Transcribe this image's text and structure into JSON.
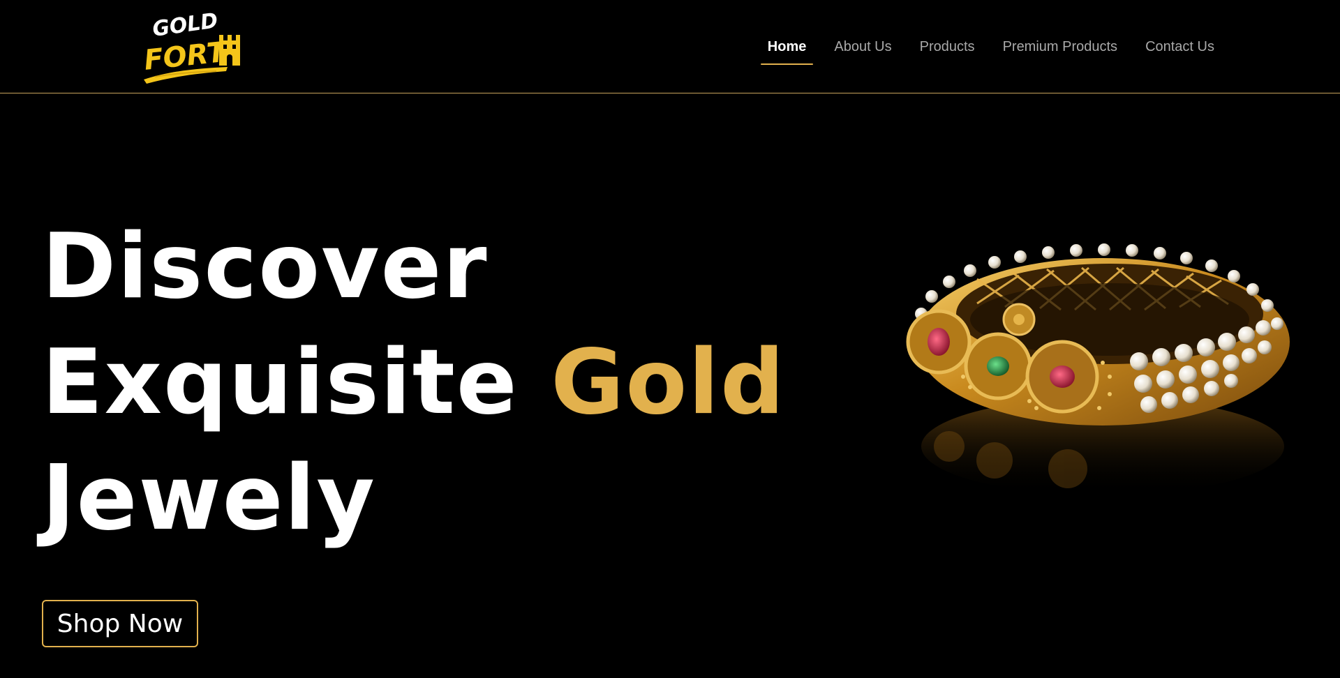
{
  "brand": {
    "logo_top": "GOLD",
    "logo_bottom": "FORT",
    "logo_icon": "castle-icon",
    "logo_color": "#f4c51a"
  },
  "nav": {
    "items": [
      {
        "label": "Home",
        "active": true
      },
      {
        "label": "About Us",
        "active": false
      },
      {
        "label": "Products",
        "active": false
      },
      {
        "label": "Premium Products",
        "active": false
      },
      {
        "label": "Contact Us",
        "active": false
      }
    ]
  },
  "hero": {
    "line1": "Discover",
    "line2_a": "Exquisite",
    "line2_b": "Gold",
    "line3": "Jewely",
    "cta_label": "Shop Now",
    "image_subject": "gold-bangle-image"
  },
  "colors": {
    "accent": "#e2b14d",
    "background": "#000000",
    "text": "#ffffff",
    "nav_inactive": "#a9a9a9"
  }
}
